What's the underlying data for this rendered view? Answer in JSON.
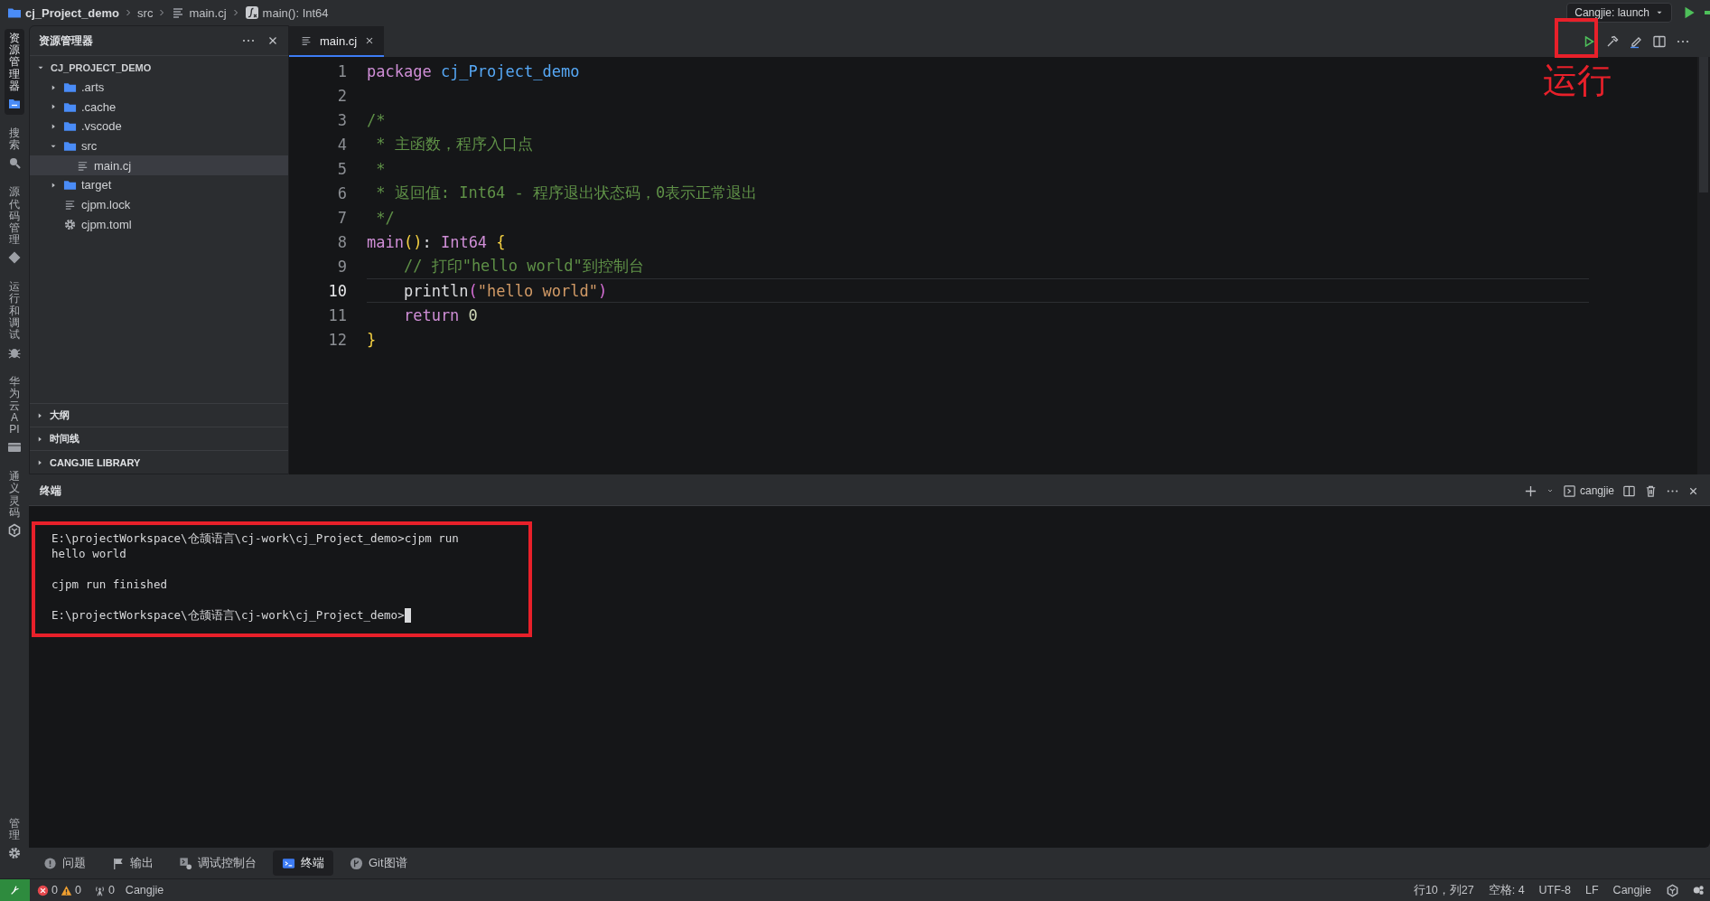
{
  "titlebar": {
    "breadcrumb": [
      {
        "text": "cj_Project_demo",
        "kind": "project"
      },
      {
        "text": "src",
        "kind": "folder"
      },
      {
        "text": "main.cj",
        "kind": "file"
      },
      {
        "text": "main(): Int64",
        "kind": "symbol"
      }
    ],
    "launch_config": "Cangjie: launch"
  },
  "activity_bar": {
    "items": [
      {
        "label": "资源管理器",
        "kind": "explorer",
        "selected": true
      },
      {
        "label": "搜索",
        "kind": "search",
        "selected": false
      },
      {
        "label": "源代码管理",
        "kind": "scm",
        "selected": false
      },
      {
        "label": "运行和调试",
        "kind": "debug",
        "selected": false
      },
      {
        "label": "华为云 API",
        "kind": "api",
        "selected": false
      },
      {
        "label": "通义灵码",
        "kind": "ai",
        "selected": false
      }
    ],
    "bottom_items": [
      {
        "label": "管理",
        "kind": "manage",
        "selected": false
      }
    ]
  },
  "sidebar": {
    "title": "资源管理器",
    "tree": {
      "label": "CJ_PROJECT_DEMO",
      "kind": "root",
      "expanded": true,
      "selected": false,
      "children": [
        {
          "label": ".arts",
          "kind": "folder",
          "expanded": false,
          "selected": false
        },
        {
          "label": ".cache",
          "kind": "folder",
          "expanded": false,
          "selected": false
        },
        {
          "label": ".vscode",
          "kind": "folder",
          "expanded": false,
          "selected": false
        },
        {
          "label": "src",
          "kind": "folder",
          "expanded": true,
          "selected": false,
          "children": [
            {
              "label": "main.cj",
              "kind": "file",
              "selected": true
            }
          ]
        },
        {
          "label": "target",
          "kind": "folder",
          "expanded": false,
          "selected": false
        },
        {
          "label": "cjpm.lock",
          "kind": "file",
          "selected": false
        },
        {
          "label": "cjpm.toml",
          "kind": "config",
          "selected": false
        }
      ]
    },
    "sections": [
      {
        "label": "大纲",
        "expanded": false
      },
      {
        "label": "时间线",
        "expanded": false
      },
      {
        "label": "CANGJIE LIBRARY",
        "expanded": false
      }
    ]
  },
  "editor": {
    "tabs": [
      {
        "label": "main.cj",
        "selected": true
      }
    ],
    "run_highlighted": true,
    "callout": "运行",
    "lines": [
      {
        "number": "1",
        "current": false,
        "tokens": [
          {
            "kind": "keyword",
            "text": "package "
          },
          {
            "kind": "package",
            "text": "cj_Project_demo"
          }
        ]
      },
      {
        "number": "2",
        "current": false
      },
      {
        "number": "3",
        "current": false,
        "tokens": [
          {
            "kind": "comment",
            "text": "/*"
          }
        ]
      },
      {
        "number": "4",
        "current": false,
        "tokens": [
          {
            "kind": "comment",
            "text": " * 主函数，程序入口点"
          }
        ]
      },
      {
        "number": "5",
        "current": false,
        "tokens": [
          {
            "kind": "comment",
            "text": " *"
          }
        ]
      },
      {
        "number": "6",
        "current": false,
        "tokens": [
          {
            "kind": "comment",
            "text": " * 返回值: Int64 - 程序退出状态码，0表示正常退出"
          }
        ]
      },
      {
        "number": "7",
        "current": false,
        "tokens": [
          {
            "kind": "comment",
            "text": " */"
          }
        ]
      },
      {
        "number": "8",
        "current": false,
        "tokens": [
          {
            "kind": "function",
            "text": "main"
          },
          {
            "kind": "bracket",
            "text": "()"
          },
          {
            "kind": "plain",
            "text": ": "
          },
          {
            "kind": "type",
            "text": "Int64 "
          },
          {
            "kind": "bracket",
            "text": "{"
          }
        ]
      },
      {
        "number": "9",
        "current": false,
        "tokens": [
          {
            "kind": "comment",
            "text": "    // 打印\"hello world\"到控制台"
          }
        ]
      },
      {
        "number": "10",
        "current": true,
        "tokens": [
          {
            "kind": "plain",
            "text": "    println"
          },
          {
            "kind": "paren",
            "text": "("
          },
          {
            "kind": "string",
            "text": "\"hello world\""
          },
          {
            "kind": "paren",
            "text": ")"
          }
        ]
      },
      {
        "number": "11",
        "current": false,
        "tokens": [
          {
            "kind": "keyword",
            "text": "    return "
          },
          {
            "kind": "number",
            "text": "0"
          }
        ]
      },
      {
        "number": "12",
        "current": false,
        "tokens": [
          {
            "kind": "bracket",
            "text": "}"
          }
        ]
      }
    ]
  },
  "panel": {
    "title": "终端",
    "profile": "cangjie",
    "highlighted": true,
    "blocks": [
      [
        "E:\\projectWorkspace\\仓颉语言\\cj-work\\cj_Project_demo>cjpm run",
        "hello world"
      ],
      [
        "cjpm run finished"
      ],
      [
        "E:\\projectWorkspace\\仓颉语言\\cj-work\\cj_Project_demo>"
      ]
    ]
  },
  "panel_tabs": [
    {
      "label": "问题",
      "kind": "problems",
      "selected": false
    },
    {
      "label": "输出",
      "kind": "output",
      "selected": false
    },
    {
      "label": "调试控制台",
      "kind": "debug",
      "selected": false
    },
    {
      "label": "终端",
      "kind": "terminal",
      "selected": true
    },
    {
      "label": "Git图谱",
      "kind": "git",
      "selected": false
    }
  ],
  "status_bar": {
    "errors": "0",
    "warnings": "0",
    "ports": "0",
    "language": "Cangjie",
    "right": [
      "行10，列27",
      "空格: 4",
      "UTF-8",
      "LF",
      "Cangjie"
    ]
  }
}
